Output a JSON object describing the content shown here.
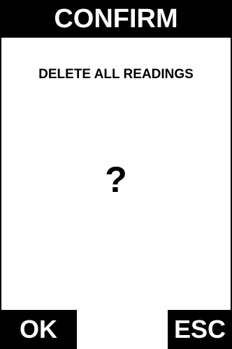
{
  "dialog": {
    "title": "CONFIRM",
    "message": "DELETE ALL READINGS",
    "prompt_symbol": "?"
  },
  "softkeys": {
    "ok_label": "OK",
    "esc_label": "ESC"
  },
  "colors": {
    "background": "#ffffff",
    "bar": "#000000",
    "bar_text": "#ffffff",
    "text": "#000000"
  }
}
